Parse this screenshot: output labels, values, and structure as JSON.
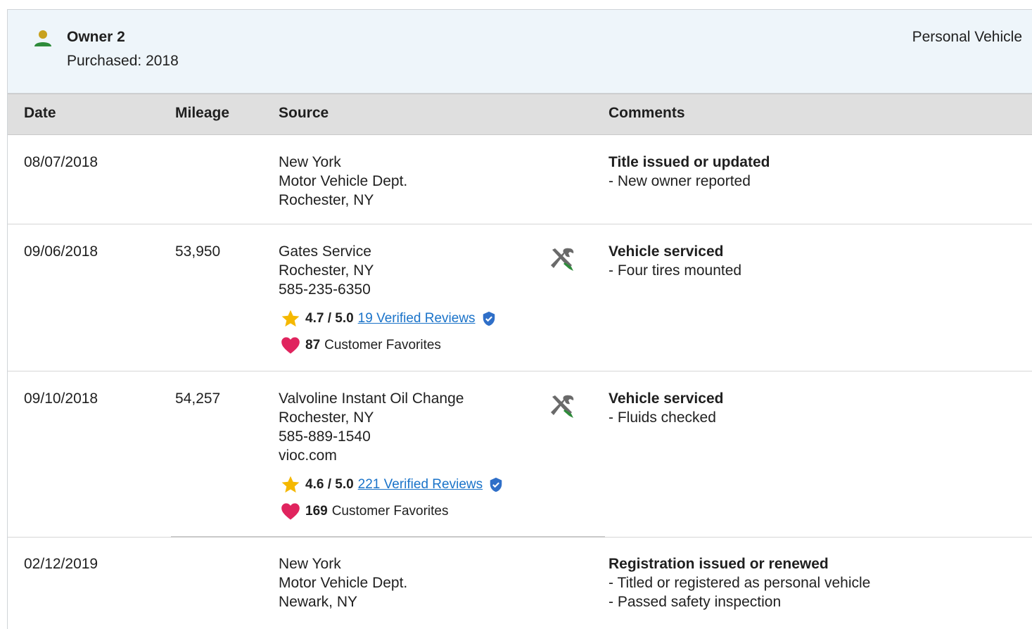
{
  "owner": {
    "title": "Owner 2",
    "purchased": "Purchased: 2018",
    "usage": "Personal Vehicle",
    "colors": {
      "icon_head": "#c8a11e",
      "icon_body": "#2e8b3a",
      "header_bg": "#eef5fa"
    }
  },
  "table": {
    "headers": {
      "date": "Date",
      "mileage": "Mileage",
      "source": "Source",
      "comments": "Comments"
    },
    "rows": [
      {
        "date": "08/07/2018",
        "mileage": "",
        "source": [
          "New York",
          "Motor Vehicle Dept.",
          "Rochester, NY"
        ],
        "comment_title": "Title issued or updated",
        "comments": [
          "- New owner reported"
        ]
      },
      {
        "date": "09/06/2018",
        "mileage": "53,950",
        "source": [
          "Gates Service",
          "Rochester, NY",
          "585-235-6350"
        ],
        "rating": "4.7 / 5.0",
        "reviews": "19 Verified Reviews",
        "favorites_count": "87",
        "favorites_label": "Customer Favorites",
        "comment_title": "Vehicle serviced",
        "comments": [
          "- Four tires mounted"
        ]
      },
      {
        "date": "09/10/2018",
        "mileage": "54,257",
        "source": [
          "Valvoline Instant Oil Change",
          "Rochester, NY",
          "585-889-1540",
          "vioc.com"
        ],
        "rating": "4.6 / 5.0",
        "reviews": "221 Verified Reviews",
        "favorites_count": "169",
        "favorites_label": "Customer Favorites",
        "comment_title": "Vehicle serviced",
        "comments": [
          "- Fluids checked"
        ]
      },
      {
        "date": "02/12/2019",
        "mileage": "",
        "source": [
          "New York",
          "Motor Vehicle Dept.",
          "Newark, NY"
        ],
        "comment_title": "Registration issued or renewed",
        "comments": [
          "- Titled or registered as personal vehicle",
          "- Passed safety inspection"
        ]
      }
    ]
  },
  "icons": {
    "owner": "person-icon",
    "service": "wrench-screwdriver-icon",
    "rating": "star-icon",
    "verified": "verified-shield-icon",
    "favorites": "heart-icon"
  },
  "colors": {
    "star": "#f5b800",
    "heart": "#e0245e",
    "link": "#1a73c9",
    "tool_green": "#2e8b3a",
    "tool_gray": "#6a6a6a"
  }
}
